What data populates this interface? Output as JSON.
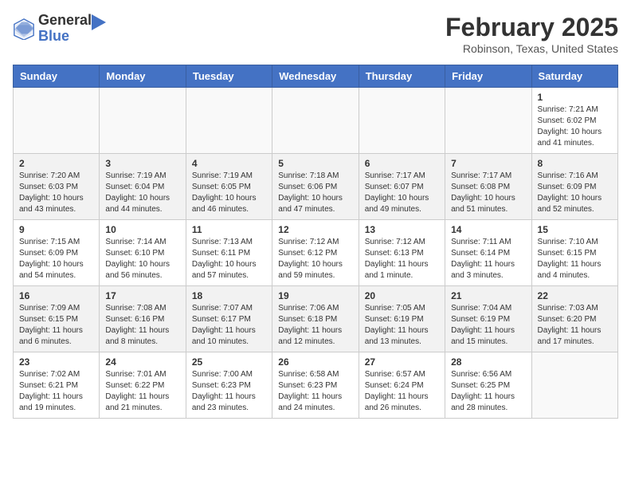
{
  "header": {
    "logo_general": "General",
    "logo_blue": "Blue",
    "month_title": "February 2025",
    "location": "Robinson, Texas, United States"
  },
  "days_of_week": [
    "Sunday",
    "Monday",
    "Tuesday",
    "Wednesday",
    "Thursday",
    "Friday",
    "Saturday"
  ],
  "weeks": [
    [
      {
        "num": "",
        "info": ""
      },
      {
        "num": "",
        "info": ""
      },
      {
        "num": "",
        "info": ""
      },
      {
        "num": "",
        "info": ""
      },
      {
        "num": "",
        "info": ""
      },
      {
        "num": "",
        "info": ""
      },
      {
        "num": "1",
        "info": "Sunrise: 7:21 AM\nSunset: 6:02 PM\nDaylight: 10 hours and 41 minutes."
      }
    ],
    [
      {
        "num": "2",
        "info": "Sunrise: 7:20 AM\nSunset: 6:03 PM\nDaylight: 10 hours and 43 minutes."
      },
      {
        "num": "3",
        "info": "Sunrise: 7:19 AM\nSunset: 6:04 PM\nDaylight: 10 hours and 44 minutes."
      },
      {
        "num": "4",
        "info": "Sunrise: 7:19 AM\nSunset: 6:05 PM\nDaylight: 10 hours and 46 minutes."
      },
      {
        "num": "5",
        "info": "Sunrise: 7:18 AM\nSunset: 6:06 PM\nDaylight: 10 hours and 47 minutes."
      },
      {
        "num": "6",
        "info": "Sunrise: 7:17 AM\nSunset: 6:07 PM\nDaylight: 10 hours and 49 minutes."
      },
      {
        "num": "7",
        "info": "Sunrise: 7:17 AM\nSunset: 6:08 PM\nDaylight: 10 hours and 51 minutes."
      },
      {
        "num": "8",
        "info": "Sunrise: 7:16 AM\nSunset: 6:09 PM\nDaylight: 10 hours and 52 minutes."
      }
    ],
    [
      {
        "num": "9",
        "info": "Sunrise: 7:15 AM\nSunset: 6:09 PM\nDaylight: 10 hours and 54 minutes."
      },
      {
        "num": "10",
        "info": "Sunrise: 7:14 AM\nSunset: 6:10 PM\nDaylight: 10 hours and 56 minutes."
      },
      {
        "num": "11",
        "info": "Sunrise: 7:13 AM\nSunset: 6:11 PM\nDaylight: 10 hours and 57 minutes."
      },
      {
        "num": "12",
        "info": "Sunrise: 7:12 AM\nSunset: 6:12 PM\nDaylight: 10 hours and 59 minutes."
      },
      {
        "num": "13",
        "info": "Sunrise: 7:12 AM\nSunset: 6:13 PM\nDaylight: 11 hours and 1 minute."
      },
      {
        "num": "14",
        "info": "Sunrise: 7:11 AM\nSunset: 6:14 PM\nDaylight: 11 hours and 3 minutes."
      },
      {
        "num": "15",
        "info": "Sunrise: 7:10 AM\nSunset: 6:15 PM\nDaylight: 11 hours and 4 minutes."
      }
    ],
    [
      {
        "num": "16",
        "info": "Sunrise: 7:09 AM\nSunset: 6:15 PM\nDaylight: 11 hours and 6 minutes."
      },
      {
        "num": "17",
        "info": "Sunrise: 7:08 AM\nSunset: 6:16 PM\nDaylight: 11 hours and 8 minutes."
      },
      {
        "num": "18",
        "info": "Sunrise: 7:07 AM\nSunset: 6:17 PM\nDaylight: 11 hours and 10 minutes."
      },
      {
        "num": "19",
        "info": "Sunrise: 7:06 AM\nSunset: 6:18 PM\nDaylight: 11 hours and 12 minutes."
      },
      {
        "num": "20",
        "info": "Sunrise: 7:05 AM\nSunset: 6:19 PM\nDaylight: 11 hours and 13 minutes."
      },
      {
        "num": "21",
        "info": "Sunrise: 7:04 AM\nSunset: 6:19 PM\nDaylight: 11 hours and 15 minutes."
      },
      {
        "num": "22",
        "info": "Sunrise: 7:03 AM\nSunset: 6:20 PM\nDaylight: 11 hours and 17 minutes."
      }
    ],
    [
      {
        "num": "23",
        "info": "Sunrise: 7:02 AM\nSunset: 6:21 PM\nDaylight: 11 hours and 19 minutes."
      },
      {
        "num": "24",
        "info": "Sunrise: 7:01 AM\nSunset: 6:22 PM\nDaylight: 11 hours and 21 minutes."
      },
      {
        "num": "25",
        "info": "Sunrise: 7:00 AM\nSunset: 6:23 PM\nDaylight: 11 hours and 23 minutes."
      },
      {
        "num": "26",
        "info": "Sunrise: 6:58 AM\nSunset: 6:23 PM\nDaylight: 11 hours and 24 minutes."
      },
      {
        "num": "27",
        "info": "Sunrise: 6:57 AM\nSunset: 6:24 PM\nDaylight: 11 hours and 26 minutes."
      },
      {
        "num": "28",
        "info": "Sunrise: 6:56 AM\nSunset: 6:25 PM\nDaylight: 11 hours and 28 minutes."
      },
      {
        "num": "",
        "info": ""
      }
    ]
  ]
}
